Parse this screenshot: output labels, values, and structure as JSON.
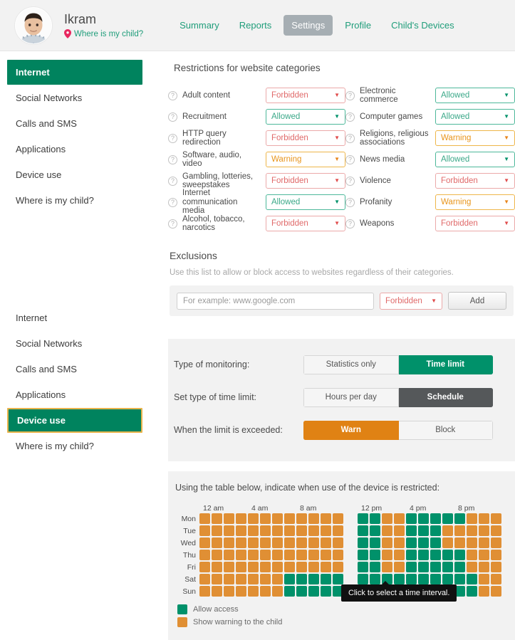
{
  "header": {
    "child_name": "Ikram",
    "location_link": "Where is my child?",
    "nav": [
      {
        "label": "Summary",
        "active": false
      },
      {
        "label": "Reports",
        "active": false
      },
      {
        "label": "Settings",
        "active": true
      },
      {
        "label": "Profile",
        "active": false
      },
      {
        "label": "Child's Devices",
        "active": false
      }
    ]
  },
  "sidebar_top": {
    "items": [
      {
        "label": "Internet",
        "active": true
      },
      {
        "label": "Social Networks",
        "active": false
      },
      {
        "label": "Calls and SMS",
        "active": false
      },
      {
        "label": "Applications",
        "active": false
      },
      {
        "label": "Device use",
        "active": false
      },
      {
        "label": "Where is my child?",
        "active": false
      }
    ]
  },
  "sidebar_bottom": {
    "items": [
      {
        "label": "Internet",
        "active": false
      },
      {
        "label": "Social Networks",
        "active": false
      },
      {
        "label": "Calls and SMS",
        "active": false
      },
      {
        "label": "Applications",
        "active": false
      },
      {
        "label": "Device use",
        "active": true
      },
      {
        "label": "Where is my child?",
        "active": false
      }
    ]
  },
  "restrictions": {
    "title": "Restrictions for website categories",
    "left_column": [
      {
        "label": "Adult content",
        "value": "Forbidden",
        "state": "forbidden"
      },
      {
        "label": "Recruitment",
        "value": "Allowed",
        "state": "allowed"
      },
      {
        "label": "HTTP query redirection",
        "value": "Forbidden",
        "state": "forbidden"
      },
      {
        "label": "Software, audio, video",
        "value": "Warning",
        "state": "warning"
      },
      {
        "label": "Gambling, lotteries, sweepstakes",
        "value": "Forbidden",
        "state": "forbidden"
      },
      {
        "label": "Internet communication media",
        "value": "Allowed",
        "state": "allowed"
      },
      {
        "label": "Alcohol, tobacco, narcotics",
        "value": "Forbidden",
        "state": "forbidden"
      }
    ],
    "right_column": [
      {
        "label": "Electronic commerce",
        "value": "Allowed",
        "state": "allowed"
      },
      {
        "label": "Computer games",
        "value": "Allowed",
        "state": "allowed"
      },
      {
        "label": "Religions, religious associations",
        "value": "Warning",
        "state": "warning"
      },
      {
        "label": "News media",
        "value": "Allowed",
        "state": "allowed"
      },
      {
        "label": "Violence",
        "value": "Forbidden",
        "state": "forbidden"
      },
      {
        "label": "Profanity",
        "value": "Warning",
        "state": "warning"
      },
      {
        "label": "Weapons",
        "value": "Forbidden",
        "state": "forbidden"
      }
    ]
  },
  "exclusions": {
    "title": "Exclusions",
    "description": "Use this list to allow or block access to websites regardless of their categories.",
    "input_value": "",
    "input_placeholder": "For example: www.google.com",
    "dropdown_value": "Forbidden",
    "dropdown_state": "forbidden",
    "add_label": "Add"
  },
  "monitoring": {
    "rows": [
      {
        "label": "Type of monitoring:",
        "options": [
          {
            "label": "Statistics only",
            "selected": false,
            "style": "none"
          },
          {
            "label": "Time limit",
            "selected": true,
            "style": "green"
          }
        ]
      },
      {
        "label": "Set type of time limit:",
        "options": [
          {
            "label": "Hours per day",
            "selected": false,
            "style": "none"
          },
          {
            "label": "Schedule",
            "selected": true,
            "style": "gray"
          }
        ]
      },
      {
        "label": "When the limit is exceeded:",
        "options": [
          {
            "label": "Warn",
            "selected": true,
            "style": "orange"
          },
          {
            "label": "Block",
            "selected": false,
            "style": "none"
          }
        ]
      }
    ]
  },
  "schedule": {
    "hint": "Using the table below, indicate when use of the device is restricted:",
    "am_labels": [
      "12 am",
      "4 am",
      "8 am"
    ],
    "pm_labels": [
      "12 pm",
      "4 pm",
      "8 pm"
    ],
    "days": [
      "Mon",
      "Tue",
      "Wed",
      "Thu",
      "Fri",
      "Sat",
      "Sun"
    ],
    "tooltip": "Click to select a time interval.",
    "legend": [
      {
        "label": "Allow access",
        "color": "#00916a",
        "key": "g"
      },
      {
        "label": "Show warning to the child",
        "color": "#e08f34",
        "key": "o"
      }
    ],
    "grid": {
      "Mon": {
        "am": [
          "o",
          "o",
          "o",
          "o",
          "o",
          "o",
          "o",
          "o",
          "o",
          "o",
          "o",
          "o"
        ],
        "pm": [
          "g",
          "g",
          "o",
          "o",
          "g",
          "g",
          "g",
          "g",
          "g",
          "o",
          "o",
          "o"
        ]
      },
      "Tue": {
        "am": [
          "o",
          "o",
          "o",
          "o",
          "o",
          "o",
          "o",
          "o",
          "o",
          "o",
          "o",
          "o"
        ],
        "pm": [
          "g",
          "g",
          "o",
          "o",
          "g",
          "g",
          "g",
          "o",
          "o",
          "o",
          "o",
          "o"
        ]
      },
      "Wed": {
        "am": [
          "o",
          "o",
          "o",
          "o",
          "o",
          "o",
          "o",
          "o",
          "o",
          "o",
          "o",
          "o"
        ],
        "pm": [
          "g",
          "g",
          "o",
          "o",
          "g",
          "g",
          "g",
          "o",
          "o",
          "o",
          "o",
          "o"
        ]
      },
      "Thu": {
        "am": [
          "o",
          "o",
          "o",
          "o",
          "o",
          "o",
          "o",
          "o",
          "o",
          "o",
          "o",
          "o"
        ],
        "pm": [
          "g",
          "g",
          "o",
          "o",
          "g",
          "g",
          "g",
          "g",
          "g",
          "o",
          "o",
          "o"
        ]
      },
      "Fri": {
        "am": [
          "o",
          "o",
          "o",
          "o",
          "o",
          "o",
          "o",
          "o",
          "o",
          "o",
          "o",
          "o"
        ],
        "pm": [
          "g",
          "g",
          "o",
          "o",
          "g",
          "g",
          "g",
          "g",
          "g",
          "o",
          "o",
          "o"
        ]
      },
      "Sat": {
        "am": [
          "o",
          "o",
          "o",
          "o",
          "o",
          "o",
          "o",
          "g",
          "g",
          "g",
          "g",
          "g"
        ],
        "pm": [
          "g",
          "g",
          "g",
          "g",
          "g",
          "g",
          "g",
          "g",
          "g",
          "g",
          "o",
          "o"
        ]
      },
      "Sun": {
        "am": [
          "o",
          "o",
          "o",
          "o",
          "o",
          "o",
          "o",
          "g",
          "g",
          "g",
          "g",
          "g"
        ],
        "pm": [
          "g",
          "g",
          "g",
          "g",
          "g",
          "g",
          "g",
          "g",
          "g",
          "g",
          "o",
          "o"
        ]
      }
    }
  }
}
